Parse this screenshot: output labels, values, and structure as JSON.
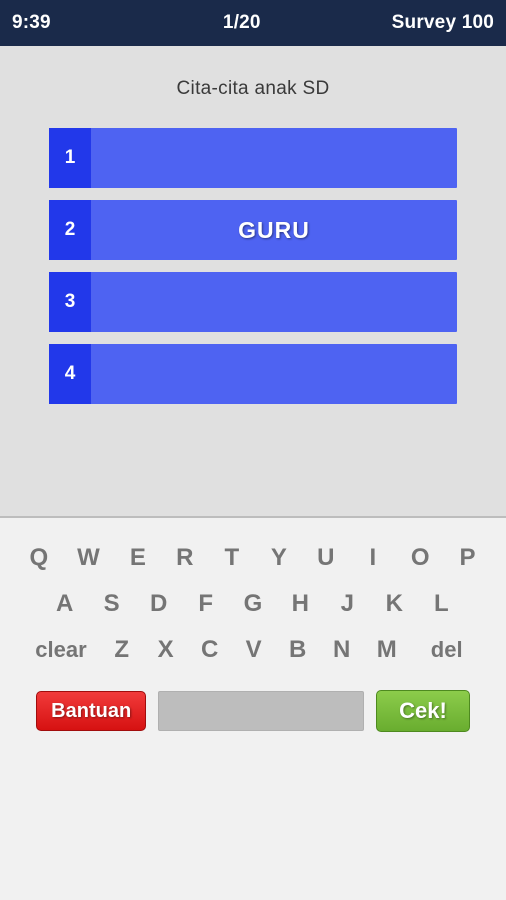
{
  "statusbar": {
    "clock": "9:39",
    "progress": "1/20",
    "title": "Survey 100"
  },
  "question": {
    "text": "Cita-cita anak SD"
  },
  "answers": [
    {
      "number": "1",
      "text": ""
    },
    {
      "number": "2",
      "text": "GURU"
    },
    {
      "number": "3",
      "text": ""
    },
    {
      "number": "4",
      "text": ""
    }
  ],
  "keyboard": {
    "row1": [
      "Q",
      "W",
      "E",
      "R",
      "T",
      "Y",
      "U",
      "I",
      "O",
      "P"
    ],
    "row2": [
      "A",
      "S",
      "D",
      "F",
      "G",
      "H",
      "J",
      "K",
      "L"
    ],
    "row3": [
      "clear",
      "Z",
      "X",
      "C",
      "V",
      "B",
      "N",
      "M",
      "del"
    ]
  },
  "bottom": {
    "help_label": "Bantuan",
    "input_value": "",
    "input_placeholder": "",
    "check_label": "Cek!"
  },
  "colors": {
    "statusbar_bg": "#1a2a4a",
    "answer_bar": "#4e63f2",
    "answer_num": "#2238ea",
    "help_button": "#d61111",
    "check_button": "#69ad2f",
    "page_bg": "#e0e0e0",
    "keyboard_bg": "#f1f1f1"
  }
}
